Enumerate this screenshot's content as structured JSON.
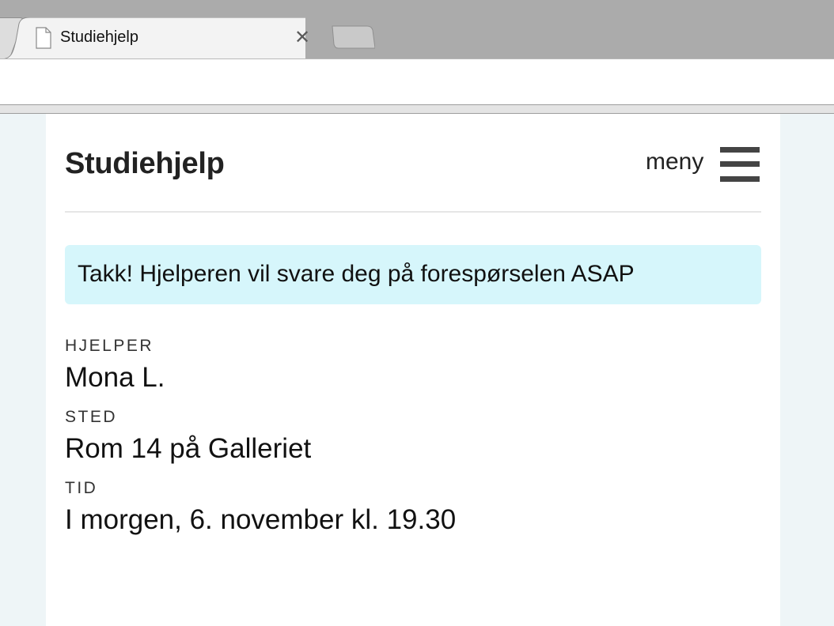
{
  "browser": {
    "tab_title": "Studiehjelp",
    "tab_close": "✕"
  },
  "header": {
    "site_title": "Studiehjelp",
    "menu_label": "meny"
  },
  "alert": {
    "message": "Takk! Hjelperen vil svare deg på forespørselen ASAP"
  },
  "details": {
    "helper_label": "HJELPER",
    "helper_value": "Mona L.",
    "place_label": "STED",
    "place_value": "Rom 14 på Galleriet",
    "time_label": "TID",
    "time_value": "I morgen, 6. november kl. 19.30"
  }
}
